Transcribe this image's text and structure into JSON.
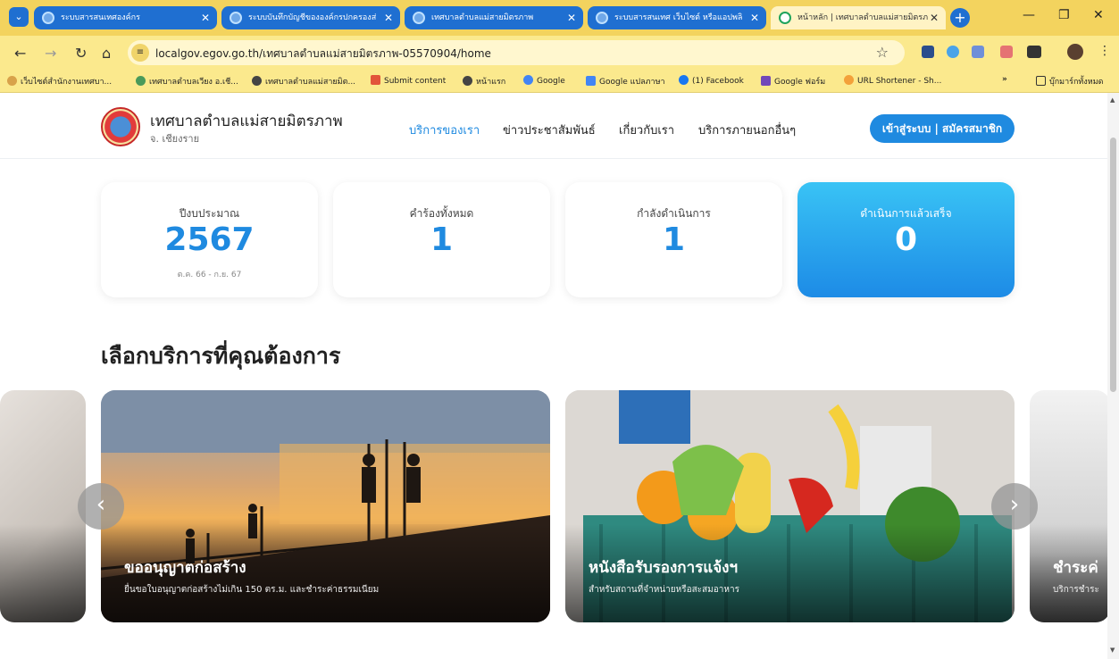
{
  "browser": {
    "tabs": [
      {
        "title": "ระบบสารสนเทศองค์กร"
      },
      {
        "title": "ระบบบันทึกบัญชีขององค์กรปกครองส่"
      },
      {
        "title": "เทศบาลตำบลแม่สายมิตรภาพ"
      },
      {
        "title": "ระบบสารสนเทศ เว็บไซต์ หรือแอปพลิ"
      },
      {
        "title": "หน้าหลัก | เทศบาลตำบลแม่สายมิตรภ"
      }
    ],
    "url": "localgov.egov.go.th/เทศบาลตำบลแม่สายมิตรภาพ-05570904/home",
    "bookmarks": [
      "เว็บไซต์สำนักงานเทศบา...",
      "เทศบาลตำบลเวียง อ.เชี...",
      "เทศบาลตำบลแม่สายมิต...",
      "Submit content",
      "หน้าแรก",
      "Google",
      "Google แปลภาษา",
      "(1) Facebook",
      "Google ฟอร์ม",
      "URL Shortener - Sh...",
      "บุ๊กมาร์กทั้งหมด"
    ]
  },
  "site": {
    "name": "เทศบาลตำบลแม่สายมิตรภาพ",
    "province": "จ. เชียงราย",
    "nav": [
      "บริการของเรา",
      "ข่าวประชาสัมพันธ์",
      "เกี่ยวกับเรา",
      "บริการภายนอกอื่นๆ"
    ],
    "login": "เข้าสู่ระบบ | สมัครสมาชิก"
  },
  "stats": [
    {
      "label": "ปีงบประมาณ",
      "value": "2567",
      "sub": "ต.ค. 66 - ก.ย. 67"
    },
    {
      "label": "คำร้องทั้งหมด",
      "value": "1"
    },
    {
      "label": "กำลังดำเนินการ",
      "value": "1"
    },
    {
      "label": "ดำเนินการแล้วเสร็จ",
      "value": "0"
    }
  ],
  "section_title": "เลือกบริการที่คุณต้องการ",
  "cards": [
    {
      "title": "ขออนุญาตก่อสร้าง",
      "desc": "ยื่นขอใบอนุญาตก่อสร้างไม่เกิน 150 ตร.ม. และชำระค่าธรรมเนียม"
    },
    {
      "title": "หนังสือรับรองการแจ้งฯ",
      "desc": "สำหรับสถานที่จำหน่ายหรือสะสมอาหาร"
    },
    {
      "title": "ชำระค่",
      "desc": "บริการชำระ"
    }
  ],
  "icons": {
    "prev": "chevron-left-icon",
    "next": "chevron-right-icon"
  },
  "colors": {
    "accent": "#1f8ae0",
    "tabbar": "#f3d35e"
  }
}
